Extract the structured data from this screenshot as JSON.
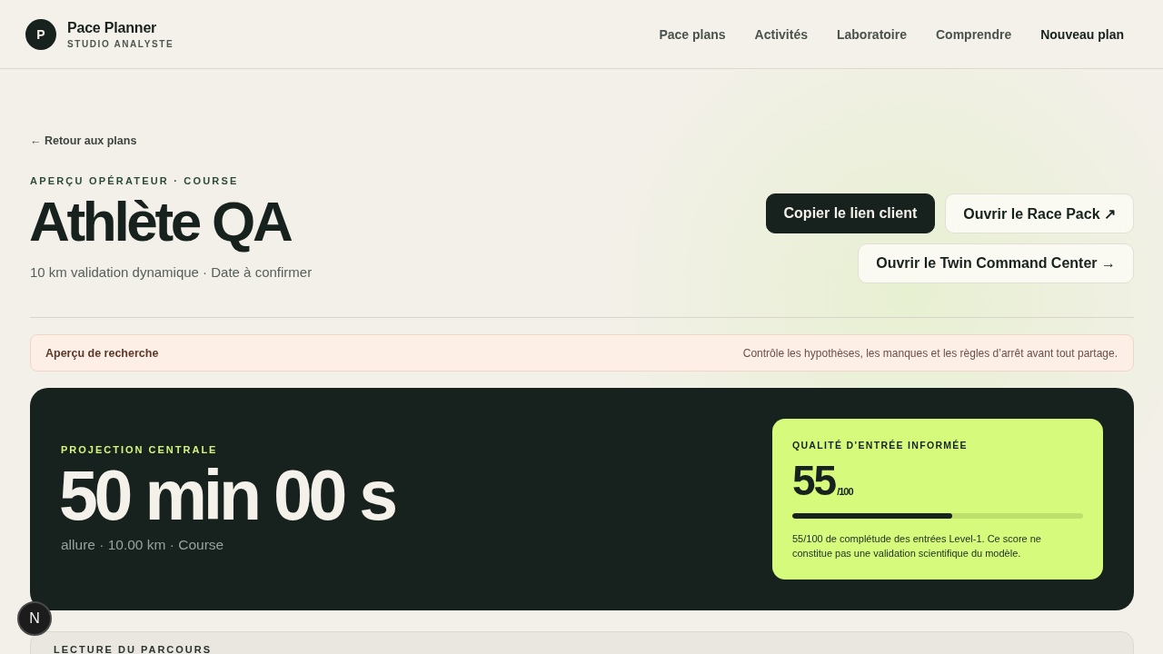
{
  "header": {
    "logo_letter": "P",
    "brand": "Pace Planner",
    "tagline": "STUDIO ANALYSTE",
    "nav": [
      {
        "label": "Pace plans",
        "kind": "link"
      },
      {
        "label": "Activités",
        "kind": "link"
      },
      {
        "label": "Laboratoire",
        "kind": "link"
      },
      {
        "label": "Comprendre",
        "kind": "link"
      },
      {
        "label": "Nouveau plan",
        "kind": "cta"
      }
    ]
  },
  "back_link": "← Retour aux plans",
  "page_header": {
    "eyebrow": "APERÇU OPÉRATEUR · COURSE",
    "title": "Athlète QA",
    "subtitle": "10 km validation dynamique · Date à confirmer",
    "actions": [
      {
        "label": "Copier le lien client",
        "kind": "primary"
      },
      {
        "label": "Ouvrir le Race Pack ↗",
        "kind": "secondary"
      },
      {
        "label": "Ouvrir le Twin Command Center →",
        "kind": "secondary"
      }
    ]
  },
  "notice": {
    "title": "Aperçu de recherche",
    "message": "Contrôle les hypothèses, les manques et les règles d’arrêt avant tout partage."
  },
  "projection": {
    "eyebrow": "PROJECTION CENTRALE",
    "value": "50 min 00 s",
    "detail": "allure · 10.00 km · Course",
    "quality": {
      "title": "QUALITÉ D’ENTRÉE INFORMÉE",
      "score": "55",
      "scale": "/100",
      "level": 0.55,
      "note": "55/100 de complétude des entrées Level-1. Ce score ne constitue pas une validation scientifique du modèle."
    }
  },
  "next_section": {
    "title": "LECTURE DU PARCOURS"
  },
  "dev_badge": {
    "label": "N"
  }
}
